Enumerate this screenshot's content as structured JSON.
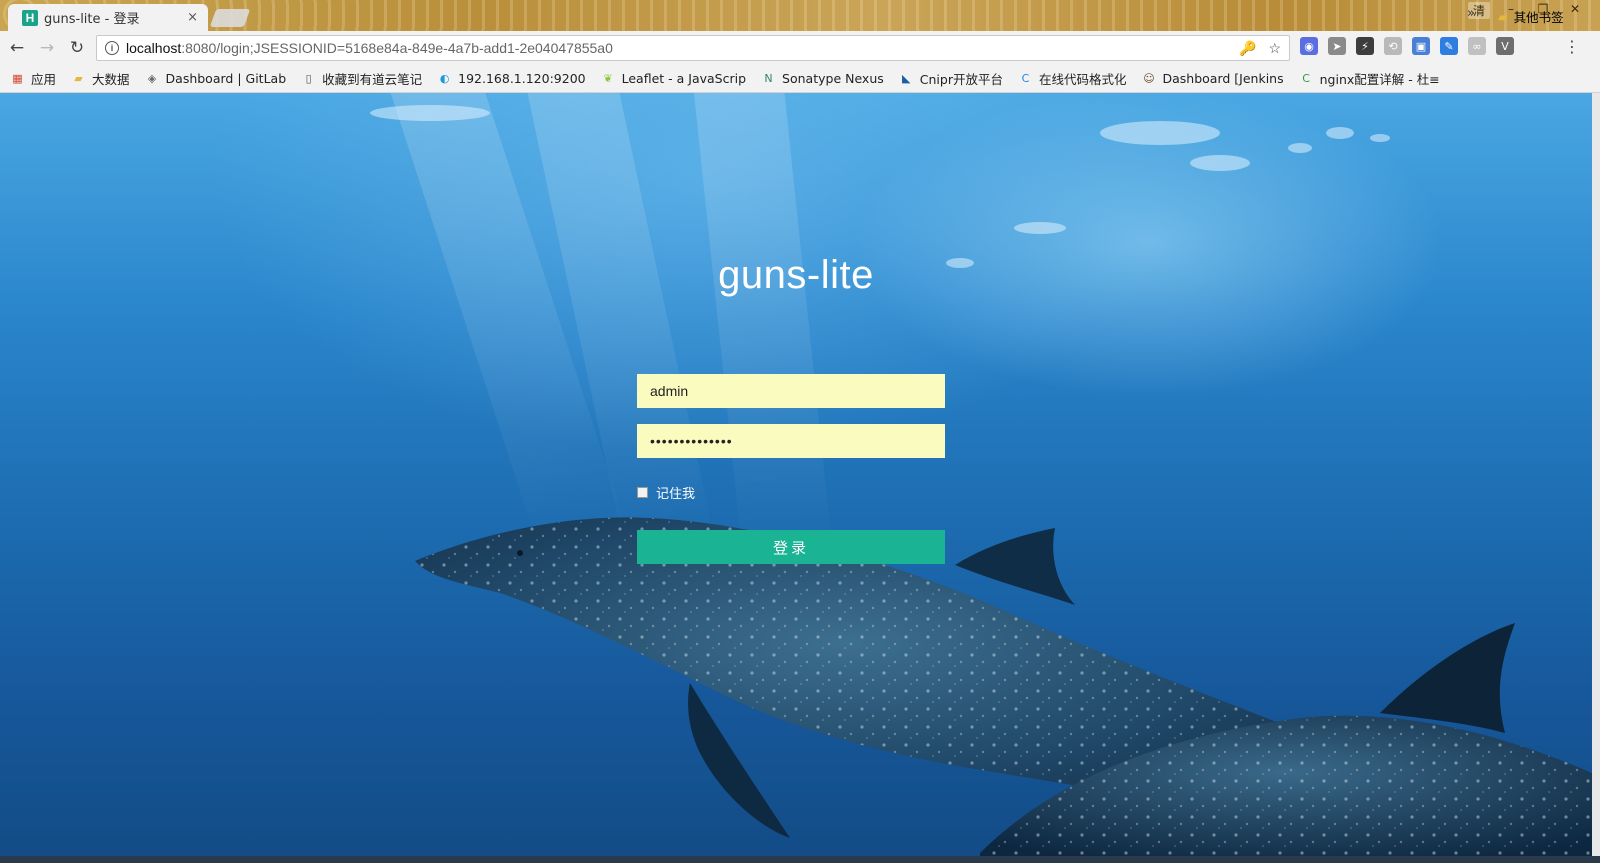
{
  "browser": {
    "tab": {
      "favicon": "H",
      "title": "guns-lite - 登录",
      "close": "×"
    },
    "window_controls": {
      "ime": "清",
      "minimize": "–",
      "restore": "❐",
      "close": "✕"
    },
    "nav": {
      "back": "←",
      "forward": "→",
      "reload": "↻"
    },
    "address": {
      "host": "localhost",
      "path": ":8080/login;JSESSIONID=5168e84a-849e-4a7b-add1-2e04047855a0"
    },
    "address_icons": {
      "key": "🔑",
      "star": "☆"
    },
    "menu": "⋮",
    "extensions": [
      {
        "name": "ext-1-icon",
        "color": "#5b6ee1",
        "glyph": "◉"
      },
      {
        "name": "ext-2-icon",
        "color": "#8a8a8a",
        "glyph": "➤"
      },
      {
        "name": "ext-3-icon",
        "color": "#3d3d3d",
        "glyph": "⚡"
      },
      {
        "name": "ext-4-icon",
        "color": "#b9b9b9",
        "glyph": "⟲"
      },
      {
        "name": "ext-5-icon",
        "color": "#4a7fd6",
        "glyph": "▣"
      },
      {
        "name": "ext-6-icon",
        "color": "#2f7de1",
        "glyph": "✎"
      },
      {
        "name": "ext-7-icon",
        "color": "#c0c0c0",
        "glyph": "∞"
      },
      {
        "name": "ext-8-icon",
        "color": "#6e6e6e",
        "glyph": "V"
      }
    ]
  },
  "bookmarks": {
    "items": [
      {
        "label": "应用",
        "icon": "apps-grid-icon",
        "glyph": "▦",
        "color": "#d0452f"
      },
      {
        "label": "大数据",
        "icon": "folder-icon",
        "glyph": "▰",
        "color": "#e5b83d"
      },
      {
        "label": "Dashboard | GitLab",
        "icon": "gitlab-icon",
        "glyph": "◈",
        "color": "#666"
      },
      {
        "label": "收藏到有道云笔记",
        "icon": "page-icon",
        "glyph": "▯",
        "color": "#555"
      },
      {
        "label": "192.168.1.120:9200",
        "icon": "elastic-icon",
        "glyph": "◐",
        "color": "#1b9ad8"
      },
      {
        "label": "Leaflet - a JavaScrip",
        "icon": "leaf-icon",
        "glyph": "❦",
        "color": "#8cc63f"
      },
      {
        "label": "Sonatype Nexus",
        "icon": "nexus-icon",
        "glyph": "N",
        "color": "#2d8a5a"
      },
      {
        "label": "Cnipr开放平台",
        "icon": "cnipr-icon",
        "glyph": "◣",
        "color": "#1b5fa3"
      },
      {
        "label": "在线代码格式化",
        "icon": "c-logo-icon",
        "glyph": "C",
        "color": "#1e88e5"
      },
      {
        "label": "Dashboard [Jenkins",
        "icon": "jenkins-icon",
        "glyph": "☺",
        "color": "#6b4a2b"
      },
      {
        "label": "nginx配置详解 - 杜≡",
        "icon": "c-green-icon",
        "glyph": "C",
        "color": "#2e9d48"
      }
    ],
    "more": "»",
    "other": {
      "label": "其他书签",
      "glyph": "▰",
      "color": "#e5b83d"
    }
  },
  "login": {
    "title": "guns-lite",
    "username": "admin",
    "password": "••••••••••••••",
    "remember_label": "记住我",
    "submit_label": "登录"
  }
}
